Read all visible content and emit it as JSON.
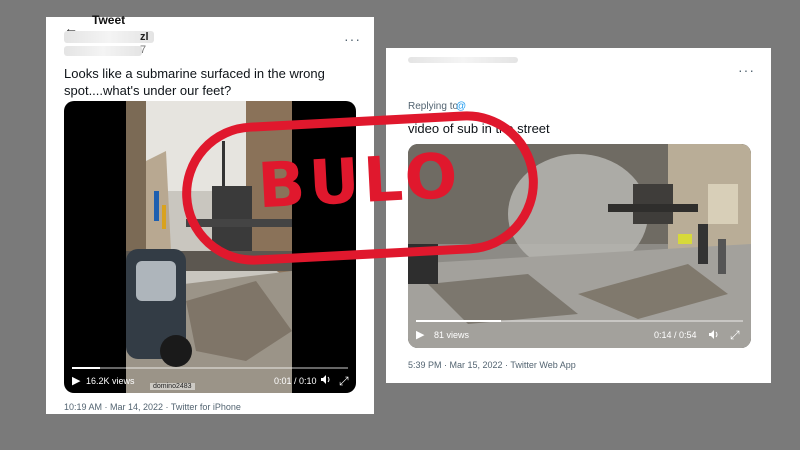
{
  "left_tweet": {
    "header_title": "Tweet",
    "name_tail": "zl",
    "handle_tail": "7",
    "text_line1": "Looks like a submarine surfaced in the wrong",
    "text_line2": "spot....what's under our feet?",
    "views": "16.2K views",
    "uploader_tag": "domino2483",
    "time_display": "0:01 / 0:10",
    "progress": 0.1,
    "timestamp": "10:19 AM · Mar 14, 2022 · Twitter for iPhone"
  },
  "right_tweet": {
    "replying_label": "Replying to",
    "text": "video of sub in the street",
    "views": "81 views",
    "time_display": "0:14 / 0:54",
    "progress": 0.26,
    "timestamp": "5:39 PM · Mar 15, 2022 · Twitter Web App"
  },
  "stamp": {
    "text": "BULO",
    "color": "#e0182d"
  },
  "icons": {
    "play": "▶",
    "volume": "🔈",
    "expand": "⤢",
    "more": "···",
    "back": "←"
  }
}
